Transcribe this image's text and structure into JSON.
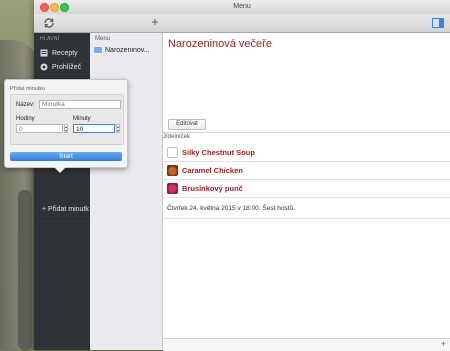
{
  "window": {
    "title": "Menu"
  },
  "sidebar": {
    "section": "HLAVNÍ",
    "items": [
      {
        "label": "Recepty",
        "icon": "recipes-icon"
      },
      {
        "label": "Prohlížeč",
        "icon": "browser-icon"
      }
    ],
    "add_timer": "+ Přidat minutk"
  },
  "list": {
    "header": "Menu",
    "items": [
      {
        "label": "Narozeninov..."
      }
    ]
  },
  "content": {
    "title": "Narozeninová večeře",
    "edit_button": "Editovat",
    "menu_header": "Jídelníček",
    "dishes": [
      {
        "name": "Silky Chestnut Soup"
      },
      {
        "name": "Caramel Chicken"
      },
      {
        "name": "Brusinkový punč"
      }
    ],
    "note": "Čtvrtek 24. května 2015 v 18:00. Šest hostů.",
    "add_button": "+"
  },
  "popover": {
    "title": "Přidat minutku",
    "name_label": "Název:",
    "name_placeholder": "Minutka",
    "hours_label": "Hodiny",
    "hours_value": "0",
    "minutes_label": "Minuty",
    "minutes_value": "10",
    "start_button": "Start"
  }
}
